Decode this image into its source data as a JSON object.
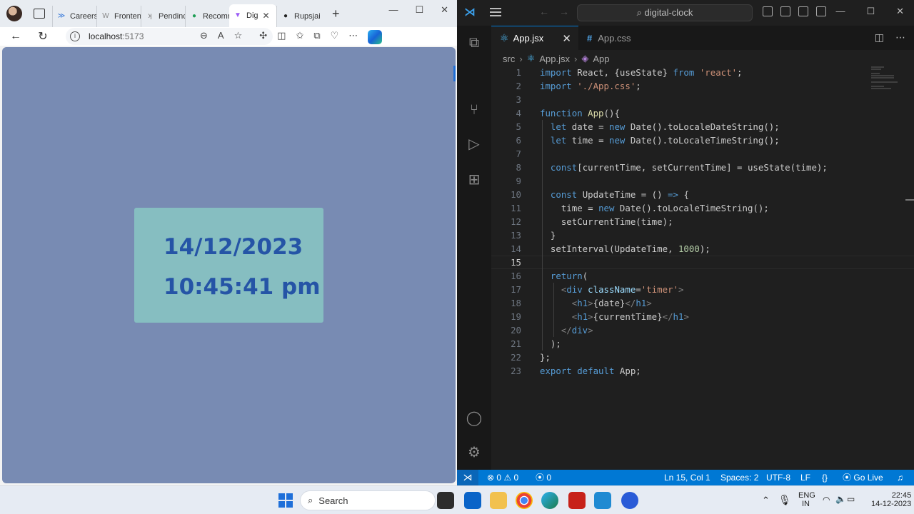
{
  "browser": {
    "tabs": [
      {
        "label": "Careers",
        "icon": "twin-arrows-icon",
        "active": false
      },
      {
        "label": "Fronten",
        "icon": "w-icon",
        "active": false
      },
      {
        "label": "Pendinc",
        "icon": "k-icon",
        "active": false
      },
      {
        "label": "Recomr",
        "icon": "green-dot-icon",
        "active": false
      },
      {
        "label": "Dig",
        "icon": "vite-icon",
        "active": true
      },
      {
        "label": "Rupsjai",
        "icon": "github-icon",
        "active": false
      }
    ],
    "url_host": "localhost",
    "url_port": ":5173",
    "page": {
      "date": "14/12/2023",
      "time": "10:45:41 pm",
      "background": "#788bb3",
      "card_color": "#86bec1",
      "text_color": "#2554a6"
    }
  },
  "vscode": {
    "search_label": "digital-clock",
    "tabs": [
      {
        "label": "App.jsx",
        "icon": "react-icon",
        "active": true
      },
      {
        "label": "App.css",
        "icon": "css-icon",
        "active": false
      }
    ],
    "breadcrumb": [
      "src",
      "App.jsx",
      "App"
    ],
    "current_line": 15,
    "code_lines": [
      [
        [
          "import ",
          "kw"
        ],
        [
          "React, {useState} ",
          "id"
        ],
        [
          "from ",
          "kw"
        ],
        [
          "'react'",
          "str"
        ],
        [
          ";",
          "id"
        ]
      ],
      [
        [
          "import ",
          "kw"
        ],
        [
          "'./App.css'",
          "str"
        ],
        [
          ";",
          "id"
        ]
      ],
      [],
      [
        [
          "function ",
          "fn"
        ],
        [
          "App",
          "fnname"
        ],
        [
          "(){",
          "id"
        ]
      ],
      [
        [
          "  "
        ],
        [
          "let ",
          "kw"
        ],
        [
          "date = ",
          "id"
        ],
        [
          "new ",
          "kw"
        ],
        [
          "Date().toLocaleDateString();",
          "id"
        ]
      ],
      [
        [
          "  "
        ],
        [
          "let ",
          "kw"
        ],
        [
          "time = ",
          "id"
        ],
        [
          "new ",
          "kw"
        ],
        [
          "Date().toLocaleTimeString();",
          "id"
        ]
      ],
      [],
      [
        [
          "  "
        ],
        [
          "const",
          "kw"
        ],
        [
          "[currentTime, setCurrentTime] = useState(time);",
          "id"
        ]
      ],
      [],
      [
        [
          "  "
        ],
        [
          "const ",
          "kw"
        ],
        [
          "UpdateTime = () ",
          "id"
        ],
        [
          "=> ",
          "kw"
        ],
        [
          "{",
          "id"
        ]
      ],
      [
        [
          "    "
        ],
        [
          "time = ",
          "id"
        ],
        [
          "new ",
          "kw"
        ],
        [
          "Date().toLocaleTimeString();",
          "id"
        ]
      ],
      [
        [
          "    "
        ],
        [
          "setCurrentTime(time);",
          "id"
        ]
      ],
      [
        [
          "  "
        ],
        [
          "}",
          "id"
        ]
      ],
      [
        [
          "  "
        ],
        [
          "setInterval(UpdateTime, ",
          "id"
        ],
        [
          "1000",
          "num"
        ],
        [
          ");",
          "id"
        ]
      ],
      [],
      [
        [
          "  "
        ],
        [
          "return",
          "kw"
        ],
        [
          "(",
          "id"
        ]
      ],
      [
        [
          "    "
        ],
        [
          "<",
          "tagp"
        ],
        [
          "div ",
          "tag"
        ],
        [
          "className",
          "attr"
        ],
        [
          "=",
          "id"
        ],
        [
          "'timer'",
          "str"
        ],
        [
          ">",
          "tagp"
        ]
      ],
      [
        [
          "      "
        ],
        [
          "<",
          "tagp"
        ],
        [
          "h1",
          "tag"
        ],
        [
          ">",
          "tagp"
        ],
        [
          "{date}",
          "id"
        ],
        [
          "</",
          "tagp"
        ],
        [
          "h1",
          "tag"
        ],
        [
          ">",
          "tagp"
        ]
      ],
      [
        [
          "      "
        ],
        [
          "<",
          "tagp"
        ],
        [
          "h1",
          "tag"
        ],
        [
          ">",
          "tagp"
        ],
        [
          "{currentTime}",
          "id"
        ],
        [
          "</",
          "tagp"
        ],
        [
          "h1",
          "tag"
        ],
        [
          ">",
          "tagp"
        ]
      ],
      [
        [
          "    "
        ],
        [
          "</",
          "tagp"
        ],
        [
          "div",
          "tag"
        ],
        [
          ">",
          "tagp"
        ]
      ],
      [
        [
          "  "
        ],
        [
          ");",
          "id"
        ]
      ],
      [
        [
          "};",
          "id"
        ]
      ],
      [
        [
          "export ",
          "kw"
        ],
        [
          "default ",
          "kw"
        ],
        [
          "App;",
          "id"
        ]
      ]
    ],
    "status": {
      "errors": "0",
      "warnings": "0",
      "ports": "0",
      "position": "Ln 15, Col 1",
      "spaces": "Spaces: 2",
      "encoding": "UTF-8",
      "eol": "LF",
      "language": "{}",
      "golive": "Go Live"
    },
    "colors": {
      "kw": "#569cd6",
      "fn": "#569cd6",
      "fnname": "#dcdcaa",
      "str": "#ce9178",
      "num": "#b5cea8",
      "tag": "#569cd6",
      "tagp": "#808080",
      "attr": "#9cdcfe",
      "id": "#cccccc",
      "status_bar": "#0078d4"
    }
  },
  "taskbar": {
    "search_label": "Search",
    "lang": "ENG",
    "region": "IN",
    "time": "22:45",
    "date": "14-12-2023"
  }
}
